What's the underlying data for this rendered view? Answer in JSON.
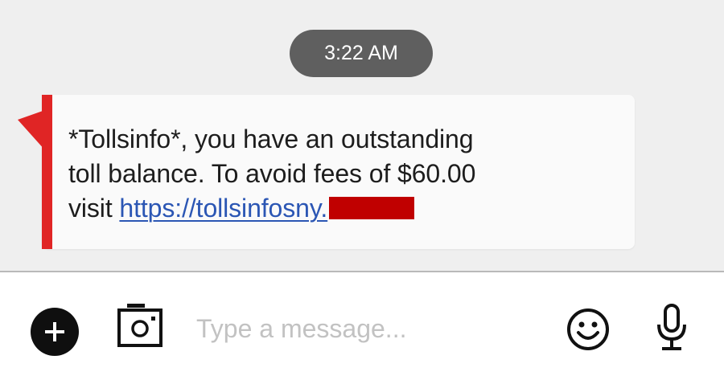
{
  "conversation": {
    "timestamp": "3:22 AM",
    "message": {
      "text": "*Tollsinfo*, you have an outstanding\ntoll balance. To avoid fees of $60.00\nvisit ",
      "link_text": "https://tollsinfosny."
    }
  },
  "composer": {
    "placeholder": "Type a message...",
    "value": "",
    "icons": {
      "add": "plus-icon",
      "camera": "camera-icon",
      "emoji": "smiley-icon",
      "voice": "microphone-icon"
    }
  },
  "colors": {
    "accent": "#e02525",
    "link": "#2b56b4",
    "redaction": "#c00000",
    "timestamp_pill": "#5f5f5f"
  }
}
